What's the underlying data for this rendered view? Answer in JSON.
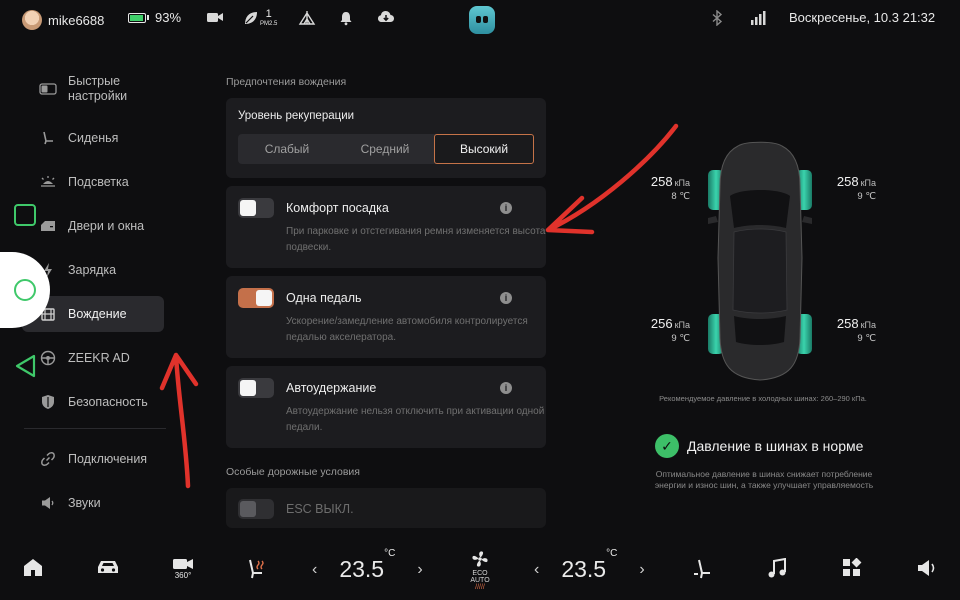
{
  "statusbar": {
    "username": "mike6688",
    "battery_percent": "93%",
    "battery_level": 0.93,
    "pm_value": "1",
    "pm_unit": "PM2.5",
    "datetime": "Воскресенье, 10.3 21:32",
    "icons": [
      "avatar-icon",
      "battery-icon",
      "camera-icon",
      "leaf-icon",
      "pm25-icon",
      "tent-icon",
      "bell-icon",
      "download-icon",
      "app-logo-icon",
      "bluetooth-icon",
      "signal-icon"
    ]
  },
  "sidebar": {
    "items": [
      {
        "label": "Быстрые настройки",
        "icon": "toggle-icon"
      },
      {
        "label": "Сиденья",
        "icon": "seat-icon"
      },
      {
        "label": "Подсветка",
        "icon": "light-icon"
      },
      {
        "label": "Двери и окна",
        "icon": "door-icon"
      },
      {
        "label": "Зарядка",
        "icon": "charging-icon"
      },
      {
        "label": "Вождение",
        "icon": "steering-icon"
      },
      {
        "label": "ZEEKR AD",
        "icon": "steering-wheel-icon"
      },
      {
        "label": "Безопасность",
        "icon": "shield-icon"
      },
      {
        "label": "Подключения",
        "icon": "link-icon"
      },
      {
        "label": "Звуки",
        "icon": "speaker-icon"
      }
    ],
    "active_index": 5
  },
  "main": {
    "section1": "Предпочтения вождения",
    "regen": {
      "title": "Уровень рекуперации",
      "options": [
        "Слабый",
        "Средний",
        "Высокий"
      ],
      "selected": "Высокий"
    },
    "comfort": {
      "label": "Комфорт посадка",
      "desc": "При парковке и отстегивания ремня изменяется высота подвески.",
      "on": false
    },
    "onepedal": {
      "label": "Одна педаль",
      "desc": "Ускорение/замедление автомобиля контролируется педалью акселератора.",
      "on": true
    },
    "autohold": {
      "label": "Автоудержание",
      "desc": "Автоудержание нельзя отключить при активации одной педали.",
      "on": false
    },
    "section2": "Особые дорожные условия",
    "esc": {
      "label": "ESC ВЫКЛ.",
      "on": false
    }
  },
  "tires": {
    "unit": "кПа",
    "temp_unit": "℃",
    "front_left": {
      "pressure": "258",
      "temp": "8"
    },
    "front_right": {
      "pressure": "258",
      "temp": "9"
    },
    "rear_left": {
      "pressure": "256",
      "temp": "9"
    },
    "rear_right": {
      "pressure": "258",
      "temp": "9"
    },
    "recommendation": "Рекомендуемое давление в холодных шинах: 260–290 кПа.",
    "status": "Давление в шинах в норме",
    "status_desc": "Оптимальное давление в шинах снижает потребление энергии и износ шин, а также улучшает управляемость"
  },
  "dock": {
    "left_temp": "23.5",
    "right_temp": "23.5",
    "temp_unit": "°C",
    "fan_label": "ECO AUTO",
    "left_chevron": "‹",
    "right_chevron": "›",
    "icons": [
      "home-icon",
      "car-icon",
      "camera-360-icon",
      "seat-heat-icon",
      "fan-icon",
      "seat-icon",
      "music-icon",
      "apps-icon",
      "volume-icon"
    ],
    "camera_label": "360°"
  },
  "colors": {
    "accent": "#c4704a",
    "ok_green": "#3dbf68",
    "tire_glow": "#2fc6a0",
    "annotation_red": "#e0322b",
    "overlay_green": "#3fc86a"
  }
}
